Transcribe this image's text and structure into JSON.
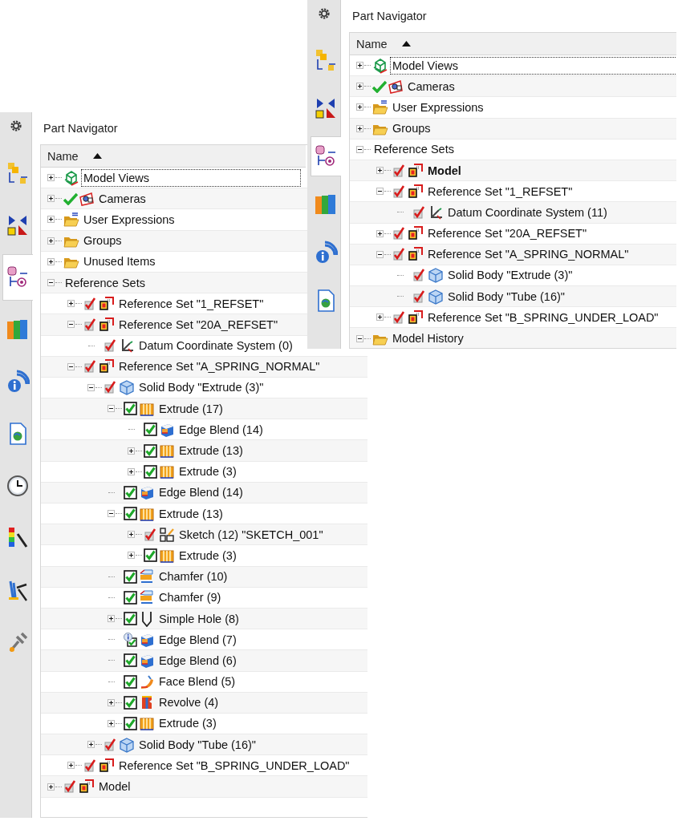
{
  "windows": [
    {
      "title": "Part Navigator",
      "column": "Name",
      "tabs": [
        {
          "kind": "assembly",
          "selected": false
        },
        {
          "kind": "constraint",
          "selected": false
        },
        {
          "kind": "part",
          "selected": true
        },
        {
          "kind": "library",
          "selected": false
        },
        {
          "kind": "info",
          "selected": false
        },
        {
          "kind": "web",
          "selected": false
        },
        {
          "kind": "history",
          "selected": false
        },
        {
          "kind": "visualization",
          "selected": false
        },
        {
          "kind": "roles",
          "selected": false
        },
        {
          "kind": "system",
          "selected": false
        }
      ],
      "tree": [
        {
          "label": "Model Views",
          "kind": "views",
          "expanded": false,
          "focused": true
        },
        {
          "label": "Cameras",
          "kind": "cameras",
          "check": {
            "kind": "tick",
            "checked": true
          },
          "expanded": false
        },
        {
          "label": "User Expressions",
          "kind": "expressions",
          "expanded": false
        },
        {
          "label": "Groups",
          "kind": "folder",
          "expanded": false
        },
        {
          "label": "Unused Items",
          "kind": "folder",
          "expanded": false
        },
        {
          "label": "Reference Sets",
          "kind": "none",
          "expanded": true,
          "children": [
            {
              "label": "Reference Set \"1_REFSET\"",
              "kind": "refset",
              "check": {
                "kind": "red",
                "checked": true
              },
              "expanded": false
            },
            {
              "label": "Reference Set \"20A_REFSET\"",
              "kind": "refset",
              "check": {
                "kind": "red",
                "checked": true
              },
              "expanded": true,
              "children": [
                {
                  "label": "Datum Coordinate System (0)",
                  "kind": "datum",
                  "check": {
                    "kind": "red",
                    "checked": true
                  }
                }
              ]
            },
            {
              "label": "Reference Set \"A_SPRING_NORMAL\"",
              "kind": "refset",
              "check": {
                "kind": "red",
                "checked": true
              },
              "expanded": true,
              "children": [
                {
                  "label": "Solid Body \"Extrude (3)\"",
                  "kind": "body",
                  "check": {
                    "kind": "red",
                    "checked": true
                  },
                  "expanded": true,
                  "children": [
                    {
                      "label": "Extrude (17)",
                      "kind": "extrude",
                      "check": {
                        "kind": "box",
                        "checked": true
                      },
                      "expanded": true,
                      "children": [
                        {
                          "label": "Edge Blend (14)",
                          "kind": "blend",
                          "check": {
                            "kind": "box",
                            "checked": true
                          }
                        },
                        {
                          "label": "Extrude (13)",
                          "kind": "extrude",
                          "check": {
                            "kind": "box",
                            "checked": true
                          },
                          "expanded": false
                        },
                        {
                          "label": "Extrude (3)",
                          "kind": "extrude",
                          "check": {
                            "kind": "box",
                            "checked": true
                          },
                          "expanded": false
                        }
                      ]
                    },
                    {
                      "label": "Edge Blend (14)",
                      "kind": "blend",
                      "check": {
                        "kind": "box",
                        "checked": true
                      }
                    },
                    {
                      "label": "Extrude (13)",
                      "kind": "extrude",
                      "check": {
                        "kind": "box",
                        "checked": true
                      },
                      "expanded": true,
                      "children": [
                        {
                          "label": "Sketch (12) \"SKETCH_001\"",
                          "kind": "sketch",
                          "check": {
                            "kind": "red",
                            "checked": true
                          },
                          "expanded": false
                        },
                        {
                          "label": "Extrude (3)",
                          "kind": "extrude",
                          "check": {
                            "kind": "box",
                            "checked": true
                          },
                          "expanded": false
                        }
                      ]
                    },
                    {
                      "label": "Chamfer (10)",
                      "kind": "chamfer",
                      "check": {
                        "kind": "box",
                        "checked": true
                      }
                    },
                    {
                      "label": "Chamfer (9)",
                      "kind": "chamfer",
                      "check": {
                        "kind": "box",
                        "checked": true
                      }
                    },
                    {
                      "label": "Simple Hole (8)",
                      "kind": "hole",
                      "check": {
                        "kind": "box",
                        "checked": true
                      },
                      "expanded": false
                    },
                    {
                      "label": "Edge Blend (7)",
                      "kind": "blend",
                      "check": {
                        "kind": "info",
                        "checked": true
                      }
                    },
                    {
                      "label": "Edge Blend (6)",
                      "kind": "blend",
                      "check": {
                        "kind": "box",
                        "checked": true
                      }
                    },
                    {
                      "label": "Face Blend (5)",
                      "kind": "faceblend",
                      "check": {
                        "kind": "box",
                        "checked": true
                      }
                    },
                    {
                      "label": "Revolve (4)",
                      "kind": "revolve",
                      "check": {
                        "kind": "box",
                        "checked": true
                      },
                      "expanded": false
                    },
                    {
                      "label": "Extrude (3)",
                      "kind": "extrude",
                      "check": {
                        "kind": "box",
                        "checked": true
                      },
                      "expanded": false
                    }
                  ]
                },
                {
                  "label": "Solid Body \"Tube (16)\"",
                  "kind": "body",
                  "check": {
                    "kind": "red",
                    "checked": true
                  },
                  "expanded": false
                }
              ]
            },
            {
              "label": "Reference Set \"B_SPRING_UNDER_LOAD\"",
              "kind": "refset",
              "check": {
                "kind": "red",
                "checked": true
              },
              "expanded": false
            }
          ]
        },
        {
          "label": "Model",
          "kind": "refset",
          "check": {
            "kind": "red",
            "checked": true
          },
          "expanded": false
        }
      ]
    },
    {
      "title": "Part Navigator",
      "column": "Name",
      "tabs": [
        {
          "kind": "assembly",
          "selected": false
        },
        {
          "kind": "constraint",
          "selected": false
        },
        {
          "kind": "part",
          "selected": true
        },
        {
          "kind": "library",
          "selected": false
        },
        {
          "kind": "info",
          "selected": false
        },
        {
          "kind": "web",
          "selected": false
        }
      ],
      "tree": [
        {
          "label": "Model Views",
          "kind": "views",
          "expanded": false,
          "focused": true
        },
        {
          "label": "Cameras",
          "kind": "cameras",
          "check": {
            "kind": "tick",
            "checked": true
          },
          "expanded": false
        },
        {
          "label": "User Expressions",
          "kind": "expressions",
          "expanded": false
        },
        {
          "label": "Groups",
          "kind": "folder",
          "expanded": false
        },
        {
          "label": "Reference Sets",
          "kind": "none",
          "expanded": true,
          "children": [
            {
              "label": "Model",
              "kind": "refset",
              "check": {
                "kind": "red",
                "checked": true
              },
              "expanded": false,
              "current": true
            },
            {
              "label": "Reference Set \"1_REFSET\"",
              "kind": "refset",
              "check": {
                "kind": "red",
                "checked": true
              },
              "expanded": true,
              "children": [
                {
                  "label": "Datum Coordinate System (11)",
                  "kind": "datum",
                  "check": {
                    "kind": "red",
                    "checked": true
                  }
                }
              ]
            },
            {
              "label": "Reference Set \"20A_REFSET\"",
              "kind": "refset",
              "check": {
                "kind": "red",
                "checked": true
              },
              "expanded": false
            },
            {
              "label": "Reference Set \"A_SPRING_NORMAL\"",
              "kind": "refset",
              "check": {
                "kind": "red",
                "checked": true
              },
              "expanded": true,
              "children": [
                {
                  "label": "Solid Body \"Extrude (3)\"",
                  "kind": "body",
                  "check": {
                    "kind": "red",
                    "checked": true
                  }
                },
                {
                  "label": "Solid Body \"Tube (16)\"",
                  "kind": "body",
                  "check": {
                    "kind": "red",
                    "checked": true
                  }
                }
              ]
            },
            {
              "label": "Reference Set \"B_SPRING_UNDER_LOAD\"",
              "kind": "refset",
              "check": {
                "kind": "red",
                "checked": true
              },
              "expanded": false
            }
          ]
        },
        {
          "label": "Model History",
          "kind": "folder",
          "expanded": true
        }
      ]
    }
  ]
}
